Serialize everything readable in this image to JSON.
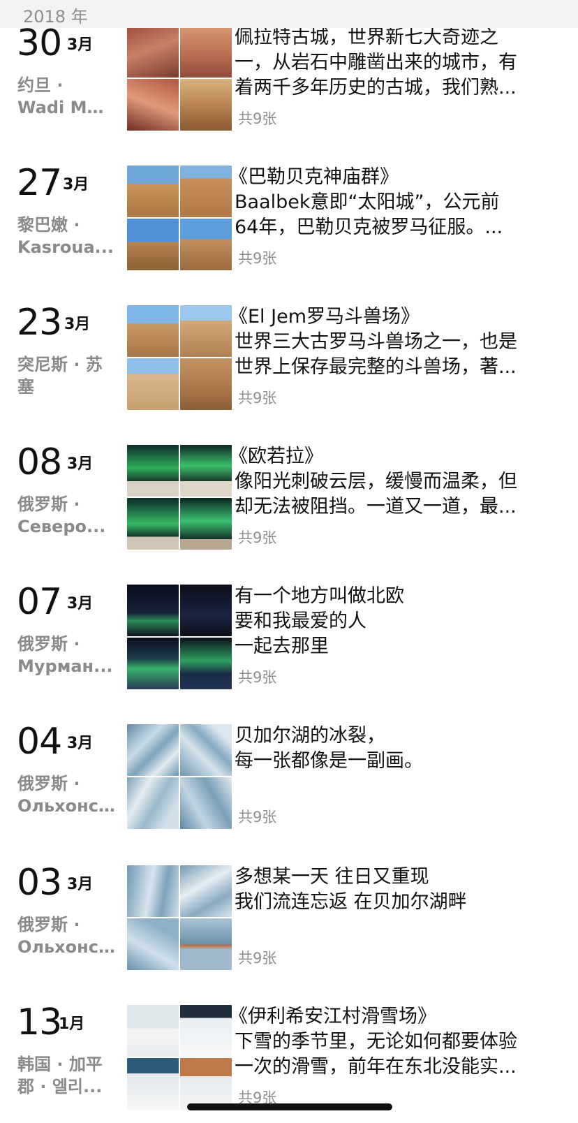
{
  "header": {
    "year": "2018 年"
  },
  "photo_count_label": "共9张",
  "entries": [
    {
      "day": "30",
      "month": "3月",
      "location": [
        "约旦 ·",
        "Wadi Mu..."
      ],
      "lines": [
        "佩拉特古城，世界新七大奇迹之",
        "一，从岩石中雕凿出来的城市，有",
        "着两千多年历史的古城，我们熟..."
      ],
      "count": "共9张",
      "thumbs": [
        "petra0",
        "petra1",
        "petra2",
        "petra3"
      ]
    },
    {
      "day": "27",
      "month": "3月",
      "location": [
        "黎巴嫩 ·",
        "Kasroua..."
      ],
      "lines": [
        "《巴勒贝克神庙群》",
        "Baalbek意即“太阳城”，公元前",
        "64年，巴勒贝克被罗马征服。..."
      ],
      "count": "共9张",
      "thumbs": [
        "baal0",
        "baal1",
        "baal2",
        "baal3"
      ]
    },
    {
      "day": "23",
      "month": "3月",
      "location": [
        "突尼斯 · 苏",
        "塞"
      ],
      "lines": [
        "《El Jem罗马斗兽场》",
        "世界三大古罗马斗兽场之一，也是",
        "世界上保存最完整的斗兽场，著..."
      ],
      "count": "共9张",
      "thumbs": [
        "jem0",
        "jem1",
        "jem2",
        "jem3"
      ]
    },
    {
      "day": "08",
      "month": "3月",
      "location": [
        "俄罗斯 ·",
        "Северо..."
      ],
      "lines": [
        "《欧若拉》",
        "像阳光刺破云层，缓慢而温柔，但",
        "却无法被阻挡。一道又一道，最..."
      ],
      "count": "共9张",
      "thumbs": [
        "aur0",
        "aur1",
        "aur2",
        "aur3"
      ]
    },
    {
      "day": "07",
      "month": "3月",
      "location": [
        "俄罗斯 ·",
        "Мурман..."
      ],
      "lines": [
        "有一个地方叫做北欧",
        "要和我最爱的人",
        "一起去那里"
      ],
      "count": "共9张",
      "thumbs": [
        "mur0",
        "mur1",
        "mur2",
        "mur3"
      ]
    },
    {
      "day": "04",
      "month": "3月",
      "location": [
        "俄罗斯 ·",
        "Ольхонс..."
      ],
      "lines": [
        "贝加尔湖的冰裂，",
        "每一张都像是一副画。"
      ],
      "count": "共9张",
      "thumbs": [
        "ice0",
        "ice1",
        "ice2",
        "ice3"
      ]
    },
    {
      "day": "03",
      "month": "3月",
      "location": [
        "俄罗斯 ·",
        "Ольхонс..."
      ],
      "lines": [
        "多想某一天 往日又重现",
        "我们流连忘返 在贝加尔湖畔"
      ],
      "count": "共9张",
      "thumbs": [
        "ice4",
        "ice5",
        "ice6",
        "ice7"
      ]
    },
    {
      "day": "13",
      "month": "1月",
      "location": [
        "韩国 · 加平",
        "郡 · 엘리..."
      ],
      "lines": [
        "《伊利希安江村滑雪场》",
        "下雪的季节里，无论如何都要体验",
        "一次的滑雪，前年在东北没能实..."
      ],
      "count": "共9张",
      "thumbs": [
        "ski0",
        "ski1",
        "ski2",
        "ski3"
      ]
    }
  ]
}
